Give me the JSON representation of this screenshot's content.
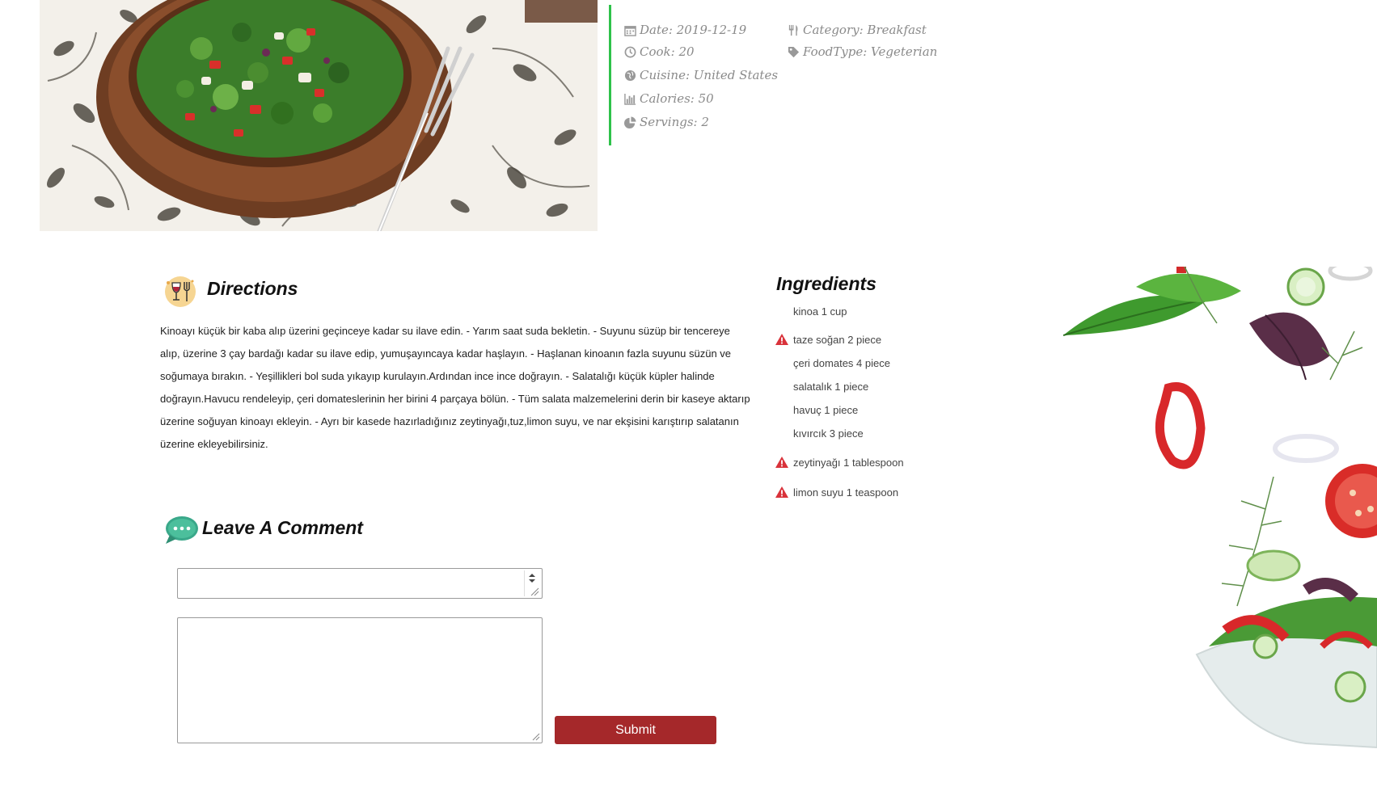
{
  "meta": {
    "date": "Date: 2019-12-19",
    "cook": "Cook: 20",
    "cuisine": "Cuisine: United States",
    "calories": "Calories: 50",
    "servings": "Servings: 2",
    "category": "Category: Breakfast",
    "foodtype": "FoodType: Vegeterian"
  },
  "directions": {
    "title": "Directions",
    "text": "Kinoayı küçük bir kaba alıp üzerini geçinceye kadar su ilave edin. - Yarım saat suda bekletin. - Suyunu süzüp bir tencereye alıp, üzerine 3 çay bardağı kadar su ilave edip, yumuşayıncaya kadar haşlayın. - Haşlanan kinoanın fazla suyunu süzün ve soğumaya bırakın. - Yeşillikleri bol suda yıkayıp kurulayın.Ardından ince ince doğrayın. - Salatalığı küçük küpler halinde doğrayın.Havucu rendeleyip, çeri domateslerinin her birini 4 parçaya bölün. - Tüm salata malzemelerini derin bir kaseye aktarıp üzerine soğuyan kinoayı ekleyin. - Ayrı bir kasede hazırladığınız zeytinyağı,tuz,limon suyu, ve nar ekşisini karıştırıp salatanın üzerine ekleyebilirsiniz."
  },
  "ingredients": {
    "title": "Ingredients",
    "items": [
      {
        "text": "kinoa 1 cup",
        "warning": false
      },
      {
        "text": "taze soğan 2 piece",
        "warning": true
      },
      {
        "text": "çeri domates 4 piece",
        "warning": false
      },
      {
        "text": "salatalık 1 piece",
        "warning": false
      },
      {
        "text": "havuç 1 piece",
        "warning": false
      },
      {
        "text": "kıvırcık 3 piece",
        "warning": false
      },
      {
        "text": "zeytinyağı 1 tablespoon",
        "warning": true
      },
      {
        "text": "limon suyu 1 teaspoon",
        "warning": true
      }
    ]
  },
  "comment": {
    "title": "Leave A Comment",
    "input_value": "",
    "textarea_value": "",
    "submit_label": "Submit"
  },
  "colors": {
    "accent_green": "#2ec24a",
    "submit_red": "#a5282a",
    "warning_red": "#d9323a"
  }
}
